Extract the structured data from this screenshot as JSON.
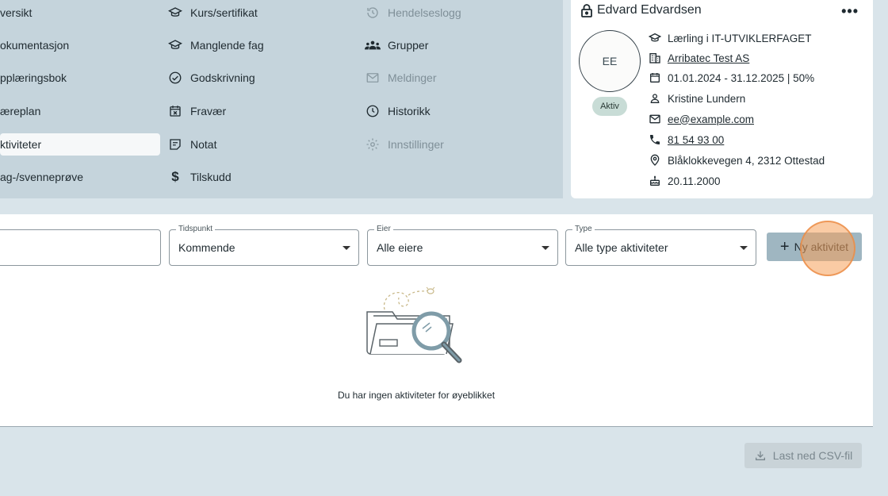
{
  "nav": {
    "col1": [
      {
        "label": "versikt"
      },
      {
        "label": "okumentasjon"
      },
      {
        "label": "pplæringsbok"
      },
      {
        "label": "æreplan"
      },
      {
        "label": "ktiviteter",
        "selected": true
      },
      {
        "label": "ag-/svenneprøve"
      }
    ],
    "col2": [
      {
        "label": "Kurs/sertifikat",
        "icon": "graduation-cap-icon"
      },
      {
        "label": "Manglende fag",
        "icon": "graduation-cap-icon"
      },
      {
        "label": "Godskrivning",
        "icon": "check-circle-icon"
      },
      {
        "label": "Fravær",
        "icon": "calendar-x-icon"
      },
      {
        "label": "Notat",
        "icon": "note-icon"
      },
      {
        "label": "Tilskudd",
        "icon": "dollar-icon"
      }
    ],
    "col3": [
      {
        "label": "Hendelseslogg",
        "icon": "history-icon",
        "disabled": true
      },
      {
        "label": "Grupper",
        "icon": "group-icon"
      },
      {
        "label": "Meldinger",
        "icon": "mail-icon",
        "disabled": true
      },
      {
        "label": "Historikk",
        "icon": "clock-icon"
      },
      {
        "label": "Innstillinger",
        "icon": "gear-icon",
        "disabled": true
      }
    ]
  },
  "profile": {
    "name": "Edvard Edvardsen",
    "initials": "EE",
    "status": "Aktiv",
    "program": "Lærling i IT-UTVIKLERFAGET",
    "company": "Arribatec Test AS",
    "period": "01.01.2024 - 31.12.2025 | 50%",
    "contact": "Kristine Lundern",
    "email": "ee@example.com",
    "phone": "81 54 93 00",
    "address": "Blåklokkevegen 4, 2312 Ottestad",
    "birthdate": "20.11.2000"
  },
  "filters": {
    "tidspunkt": {
      "label": "Tidspunkt",
      "value": "Kommende"
    },
    "eier": {
      "label": "Eier",
      "value": "Alle eiere"
    },
    "type": {
      "label": "Type",
      "value": "Alle type aktiviteter"
    }
  },
  "actions": {
    "new_activity": "Ny aktivitet",
    "download_csv": "Last ned CSV-fil"
  },
  "empty_state": "Du har ingen aktiviteter for øyeblikket",
  "colors": {
    "nav_bg": "#c5d4dc",
    "page_bg": "#d9e4ea",
    "button_bg": "#9fb6c1",
    "status_bg": "#c8dcd6",
    "highlight": "#f5a05a"
  }
}
